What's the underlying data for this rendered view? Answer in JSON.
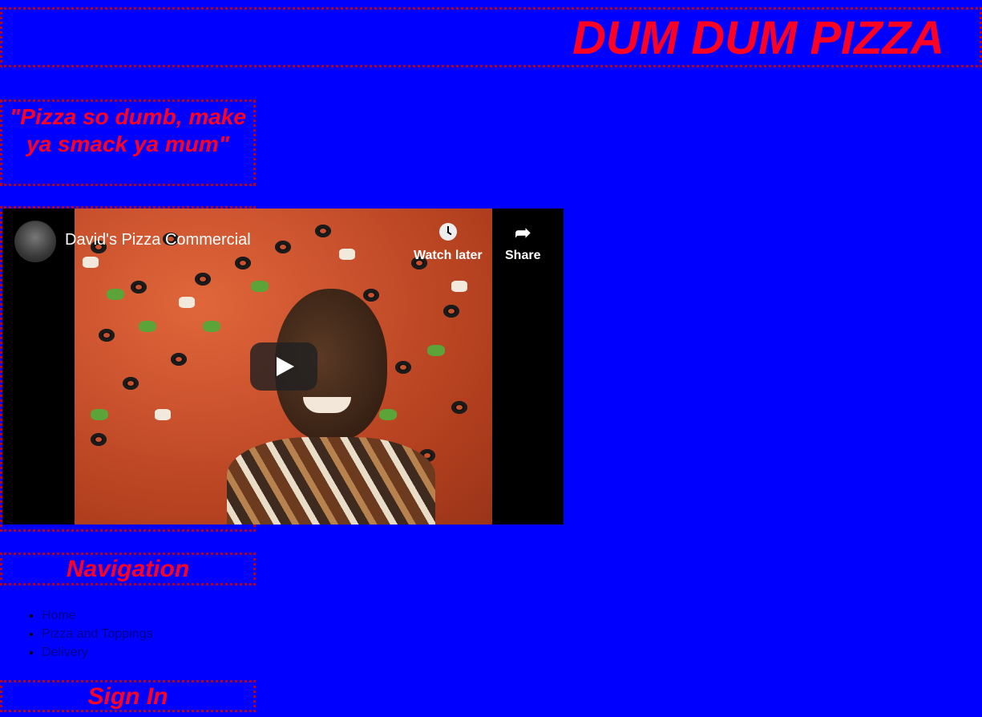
{
  "header": {
    "title": "DUM DUM PIZZA"
  },
  "slogan": {
    "text": "\"Pizza so dumb, make ya smack ya mum\""
  },
  "video": {
    "title": "David's Pizza Commercial",
    "watch_later_label": "Watch later",
    "share_label": "Share",
    "icons": [
      "clock-icon",
      "share-icon",
      "play-icon"
    ]
  },
  "navigation": {
    "heading": "Navigation",
    "items": [
      {
        "label": "Home"
      },
      {
        "label": "Pizza and Toppings"
      },
      {
        "label": "Delivery"
      }
    ]
  },
  "signin": {
    "heading": "Sign In"
  },
  "colors": {
    "background": "#0000ff",
    "accent_text": "#ff0022",
    "border": "#b8001a"
  }
}
